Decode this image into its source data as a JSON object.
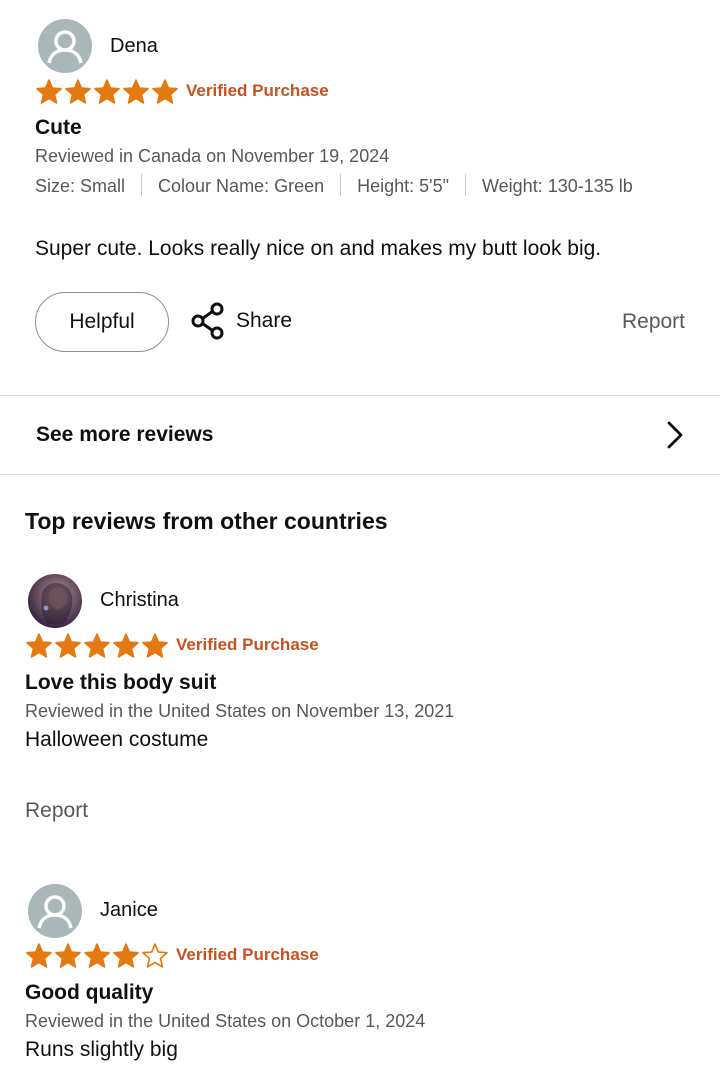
{
  "colors": {
    "star": "#e47911",
    "verified": "#c7511f",
    "muted": "#565959",
    "text": "#0f1111"
  },
  "reviews_top": {
    "author": "Dena",
    "rating": 5,
    "verified": "Verified Purchase",
    "title": "Cute",
    "reviewed_on": "Reviewed in Canada on November 19, 2024",
    "attributes": [
      "Size: Small",
      "Colour Name: Green",
      "Height: 5'5\"",
      "Weight: 130-135 lb"
    ],
    "body": "Super cute. Looks really nice on and makes my butt look big.",
    "helpful_label": "Helpful",
    "share_label": "Share",
    "report_label": "Report"
  },
  "see_more": {
    "label": "See more reviews"
  },
  "other_countries": {
    "heading": "Top reviews from other countries",
    "reviews": [
      {
        "author": "Christina",
        "rating": 5,
        "verified": "Verified Purchase",
        "title": "Love this body suit",
        "reviewed_on": "Reviewed in the United States on November 13, 2021",
        "body": "Halloween costume",
        "report_label": "Report"
      },
      {
        "author": "Janice",
        "rating": 4,
        "verified": "Verified Purchase",
        "title": "Good quality",
        "reviewed_on": "Reviewed in the United States on October 1, 2024",
        "body": "Runs slightly big"
      }
    ]
  }
}
